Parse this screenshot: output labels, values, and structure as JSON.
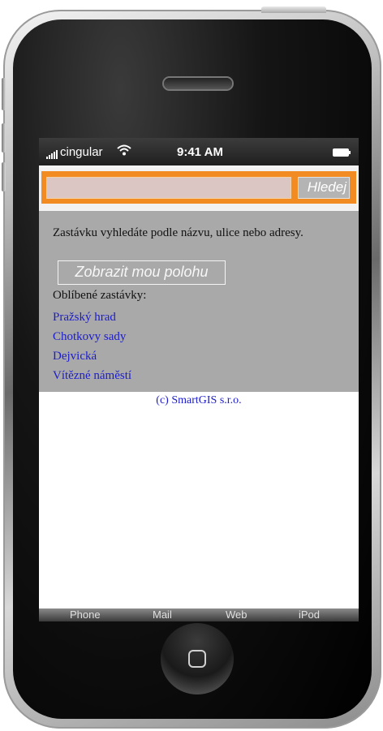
{
  "status_bar": {
    "carrier": "cingular",
    "time": "9:41 AM"
  },
  "search": {
    "value": "",
    "placeholder": "",
    "button_label": "Hledej"
  },
  "info": {
    "text": "Zastávku vyhledáte podle názvu, ulice nebo adresy.",
    "locate_button": "Zobrazit mou polohu",
    "favorites_heading": "Oblíbené zastávky:",
    "favorites": [
      "Pražský hrad",
      "Chotkovy sady",
      "Dejvická",
      "Vítězné náměstí"
    ]
  },
  "footer": {
    "copyright": "(c) SmartGIS s.r.o."
  },
  "tab_bar": {
    "tabs": [
      "Phone",
      "Mail",
      "Web",
      "iPod"
    ]
  },
  "colors": {
    "accent_orange": "#f28c22",
    "panel_gray": "#a9a9a9",
    "link_blue": "#1c1ccc"
  },
  "icons": [
    "signal-icon",
    "wifi-icon",
    "battery-icon",
    "home-button-icon"
  ]
}
